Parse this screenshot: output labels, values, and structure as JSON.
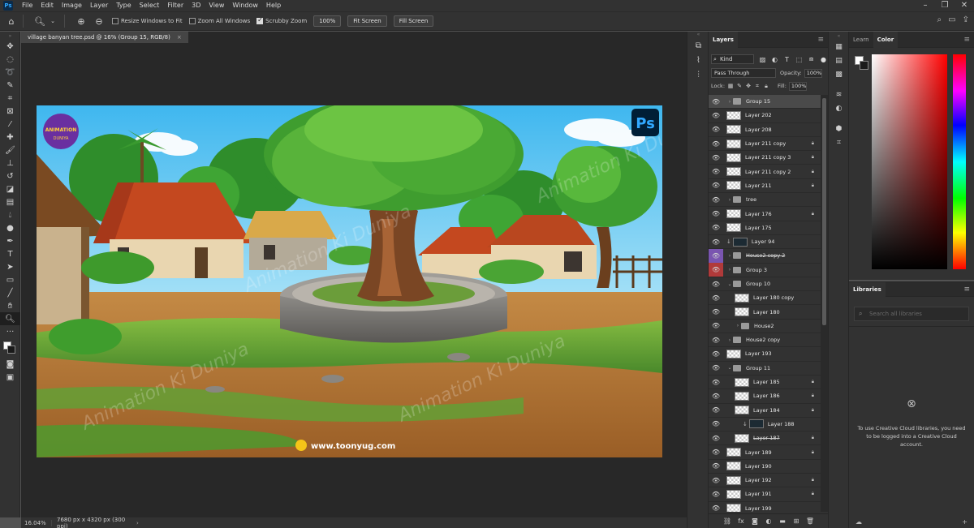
{
  "menubar": {
    "logo": "Ps",
    "items": [
      "File",
      "Edit",
      "Image",
      "Layer",
      "Type",
      "Select",
      "Filter",
      "3D",
      "View",
      "Window",
      "Help"
    ],
    "window_controls": [
      "–",
      "❐",
      "✕"
    ]
  },
  "options": {
    "resize_windows": "Resize Windows to Fit",
    "zoom_all": "Zoom All Windows",
    "scrubby": "Scrubby Zoom",
    "zoom_value": "100%",
    "fit_screen": "Fit Screen",
    "fill_screen": "Fill Screen"
  },
  "document": {
    "tab_title": "village banyan tree.psd @ 16% (Group 15, RGB/8)",
    "tab_close": "×"
  },
  "artwork": {
    "watermark": "Animation Ki Duniya",
    "footer_url": "www.toonyug.com",
    "ps_badge": "Ps",
    "logo_text": "ANIMATION",
    "logo_sub": "DUNIYA"
  },
  "status": {
    "zoom": "16.04%",
    "doc_info": "7680 px x 4320 px (300 ppi)",
    "chevron": "›"
  },
  "layers_panel": {
    "title": "Layers",
    "kind": "Kind",
    "blend_mode": "Pass Through",
    "opacity_label": "Opacity:",
    "opacity_value": "100%",
    "lock_label": "Lock:",
    "fill_label": "Fill:",
    "fill_value": "100%",
    "layers": [
      {
        "name": "Group 15",
        "type": "group",
        "indent": 0,
        "selected": true
      },
      {
        "name": "Layer 202",
        "type": "layer",
        "indent": 0
      },
      {
        "name": "Layer 208",
        "type": "layer",
        "indent": 0
      },
      {
        "name": "Layer 211 copy",
        "type": "layer",
        "indent": 0,
        "locked": true
      },
      {
        "name": "Layer 211 copy 3",
        "type": "layer",
        "indent": 0,
        "locked": true
      },
      {
        "name": "Layer 211 copy 2",
        "type": "layer",
        "indent": 0,
        "locked": true
      },
      {
        "name": "Layer 211",
        "type": "layer",
        "indent": 0,
        "locked": true
      },
      {
        "name": "tree",
        "type": "group",
        "indent": 0
      },
      {
        "name": "Layer 176",
        "type": "layer",
        "indent": 0,
        "locked": true
      },
      {
        "name": "Layer 175",
        "type": "layer",
        "indent": 0
      },
      {
        "name": "Layer 94",
        "type": "layer",
        "indent": 0,
        "clip": true,
        "dark": true
      },
      {
        "name": "House2 copy 2",
        "type": "group",
        "indent": 0,
        "eye": "purple",
        "strike": true
      },
      {
        "name": "Group 3",
        "type": "group",
        "indent": 0,
        "eye": "red"
      },
      {
        "name": "Group 10",
        "type": "group",
        "indent": 0,
        "open": true
      },
      {
        "name": "Layer 180 copy",
        "type": "layer",
        "indent": 1
      },
      {
        "name": "Layer 180",
        "type": "layer",
        "indent": 1
      },
      {
        "name": "House2",
        "type": "group",
        "indent": 1
      },
      {
        "name": "House2 copy",
        "type": "group",
        "indent": 0
      },
      {
        "name": "Layer 193",
        "type": "layer",
        "indent": 0
      },
      {
        "name": "Group 11",
        "type": "group",
        "indent": 0,
        "open": true
      },
      {
        "name": "Layer 185",
        "type": "layer",
        "indent": 1,
        "locked": true
      },
      {
        "name": "Layer 186",
        "type": "layer",
        "indent": 1,
        "locked": true
      },
      {
        "name": "Layer 184",
        "type": "layer",
        "indent": 1,
        "locked": true
      },
      {
        "name": "Layer 188",
        "type": "layer",
        "indent": 2,
        "clip": true,
        "dark": true
      },
      {
        "name": "Layer 187",
        "type": "layer",
        "indent": 1,
        "locked": true,
        "strike": true
      },
      {
        "name": "Layer 189",
        "type": "layer",
        "indent": 0,
        "locked": true
      },
      {
        "name": "Layer 190",
        "type": "layer",
        "indent": 0
      },
      {
        "name": "Layer 192",
        "type": "layer",
        "indent": 0,
        "locked": true
      },
      {
        "name": "Layer 191",
        "type": "layer",
        "indent": 0,
        "locked": true
      },
      {
        "name": "Layer 199",
        "type": "layer",
        "indent": 0
      }
    ]
  },
  "color_panel": {
    "tab_learn": "Learn",
    "tab_color": "Color"
  },
  "libraries_panel": {
    "title": "Libraries",
    "search_placeholder": "Search all libraries",
    "message": "To use Creative Cloud libraries, you need to be logged into a Creative Cloud account."
  }
}
